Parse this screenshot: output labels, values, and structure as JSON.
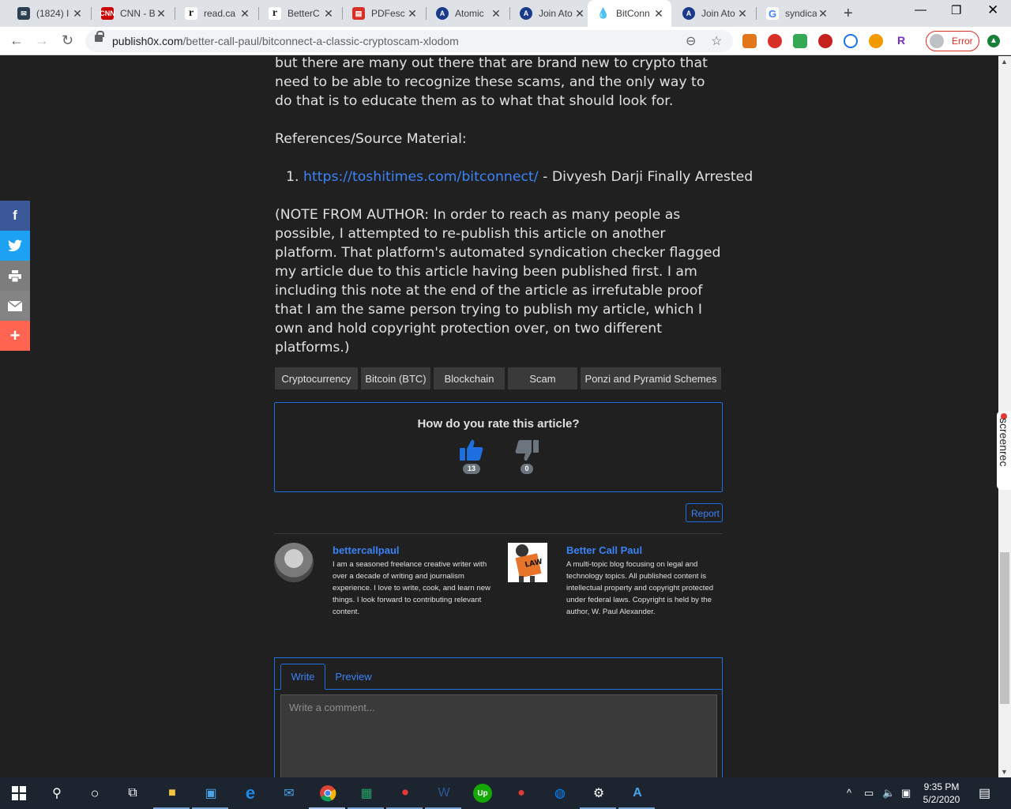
{
  "browser": {
    "tabs": [
      {
        "title": "(1824) I",
        "icon": "mail-icon",
        "color": "#2d3e50"
      },
      {
        "title": "CNN - B",
        "icon": "cnn-icon",
        "color": "#cc0000"
      },
      {
        "title": "read.ca",
        "icon": "r-icon",
        "color": "#222222"
      },
      {
        "title": "BetterC",
        "icon": "r-icon",
        "color": "#222222"
      },
      {
        "title": "PDFesc",
        "icon": "pdf-icon",
        "color": "#d93025"
      },
      {
        "title": "Atomic",
        "icon": "atomic-icon",
        "color": "#1a3a8a"
      },
      {
        "title": "Join Ato",
        "icon": "atomic-icon",
        "color": "#1a3a8a"
      },
      {
        "title": "BitConn",
        "icon": "drop-icon",
        "color": "#5f6368"
      },
      {
        "title": "Join Ato",
        "icon": "atomic-icon",
        "color": "#1a3a8a"
      },
      {
        "title": "syndica",
        "icon": "google-icon",
        "color": "#4285f4"
      }
    ],
    "url_host": "publish0x.com",
    "url_path": "/better-call-paul/bitconnect-a-classic-cryptoscam-xlodom",
    "profile_label": "Error"
  },
  "article": {
    "para_end": "but there are many out there that are brand new to crypto that need to be able to recognize these scams, and the only way to do that is to educate them as to what that should look for.",
    "refs_heading": "References/Source Material:",
    "ref_number": "1.",
    "ref_link": "https://toshitimes.com/bitconnect/",
    "ref_desc": " - Divyesh Darji Finally Arrested",
    "note": "(NOTE FROM AUTHOR:  In order to reach as many people as possible, I attempted to re-publish this article on another platform.  That platform's automated syndication checker flagged my article due to this article having been published first.  I am including this note at the end of the article as irrefutable proof that I am the same person trying to publish my article, which I own and hold copyright protection over, on two different platforms.)"
  },
  "tags": [
    "Cryptocurrency",
    "Bitcoin (BTC)",
    "Blockchain",
    "Scam",
    "Ponzi and Pyramid Schemes"
  ],
  "rating": {
    "question": "How do you rate this article?",
    "up_count": "13",
    "down_count": "0"
  },
  "report_label": "Report",
  "authors": [
    {
      "name": "bettercallpaul",
      "bio": "I am a seasoned freelance creative writer with over a decade of writing and journalism experience. I love to write, cook, and learn new things. I look forward to contributing relevant content."
    },
    {
      "name": "Better Call Paul",
      "bio": "A multi-topic blog focusing on legal and technology topics. All published content is intellectual property and copyright protected under federal laws. Copyright is held by the author, W. Paul Alexander."
    }
  ],
  "comment": {
    "tab_write": "Write",
    "tab_preview": "Preview",
    "placeholder": "Write a comment..."
  },
  "screenrec_label": "screenrec",
  "taskbar": {
    "time": "9:35 PM",
    "date": "5/2/2020"
  },
  "colors": {
    "accent": "#1d6fe0",
    "link": "#3b82f6",
    "page_bg": "#202020",
    "facebook": "#3b5998",
    "twitter": "#1da1f2",
    "print": "#7d7d7d",
    "email": "#848484",
    "more": "#ff6550"
  }
}
